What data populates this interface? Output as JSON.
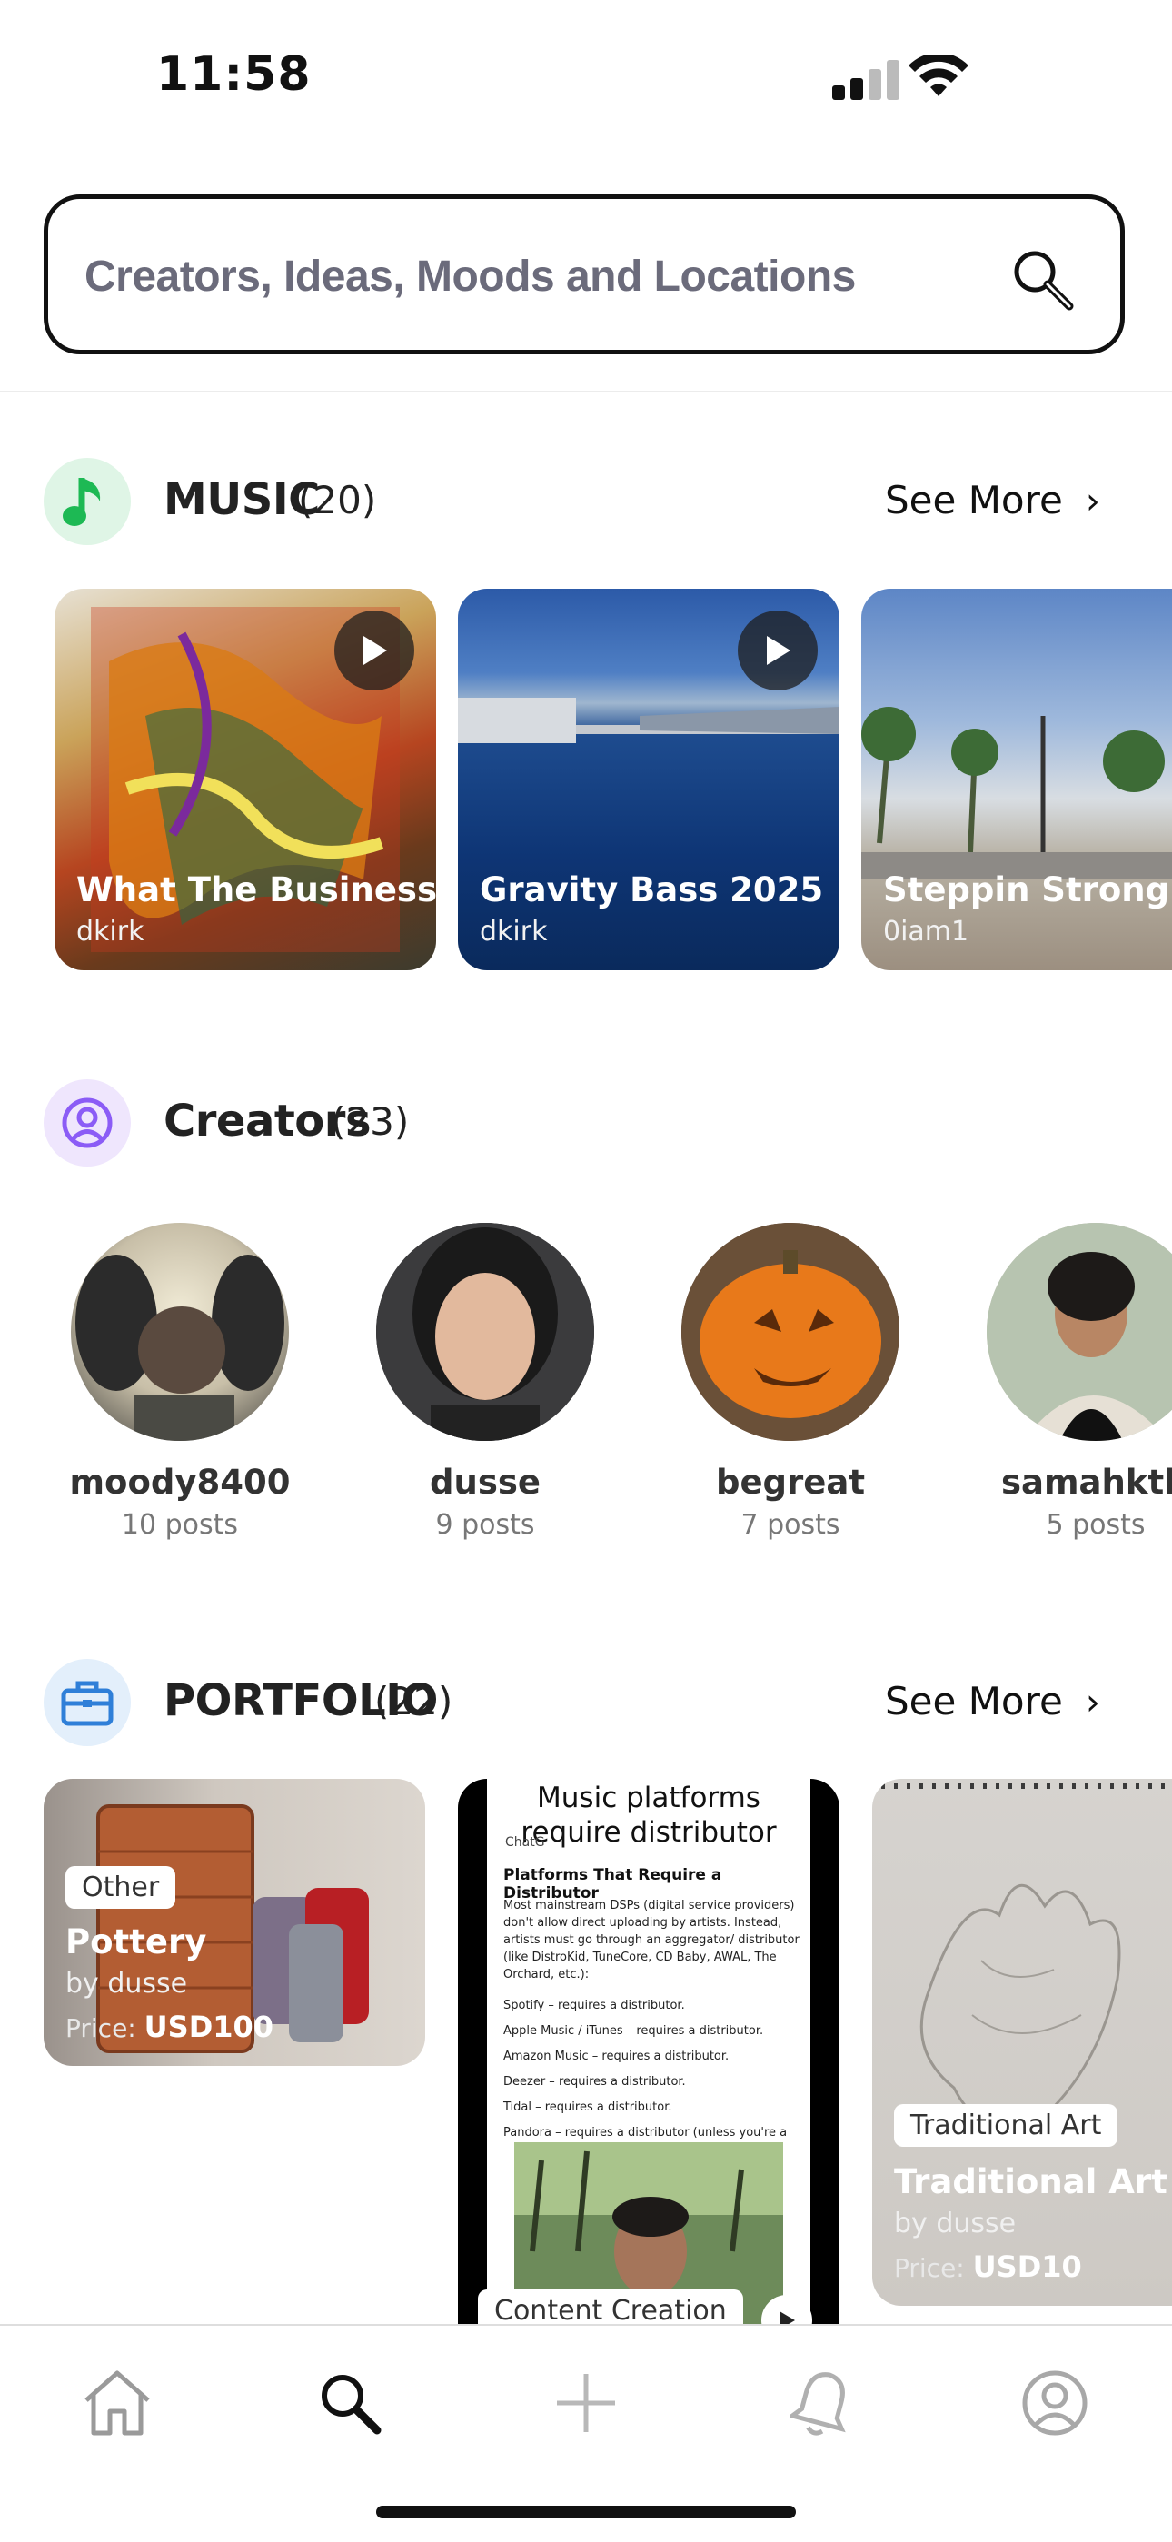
{
  "status": {
    "time": "11:58"
  },
  "search": {
    "placeholder": "Creators, Ideas, Moods and Locations"
  },
  "music": {
    "title": "MUSIC",
    "count": "(20)",
    "see_more": "See More",
    "icon": "music-note-icon",
    "accent": "#1db954",
    "items": [
      {
        "title": "What The Business (P..",
        "author": "dkirk"
      },
      {
        "title": "Gravity Bass 2025",
        "author": "dkirk"
      },
      {
        "title": "Steppin Strong",
        "author": "0iam1"
      }
    ]
  },
  "creators": {
    "title": "Creators",
    "count": "(23)",
    "icon": "user-circle-icon",
    "accent": "#8b5cf6",
    "items": [
      {
        "name": "moody8400",
        "posts": "10 posts"
      },
      {
        "name": "dusse",
        "posts": "9 posts"
      },
      {
        "name": "begreat",
        "posts": "7 posts"
      },
      {
        "name": "samahktha",
        "posts": "5 posts"
      }
    ]
  },
  "portfolio": {
    "title": "PORTFOLIO",
    "count": "(22)",
    "see_more": "See More",
    "icon": "briefcase-icon",
    "accent": "#2f7fd8",
    "items": [
      {
        "tag": "Other",
        "title": "Pottery",
        "by": "by dusse",
        "price_label": "Price:",
        "price": "USD100"
      },
      {
        "tag": "Content Creation",
        "headline": "Music platforms require distributor",
        "doc_header": "ChatG",
        "doc_title": "Platforms That Require a Distributor",
        "doc_body": "Most mainstream DSPs (digital service providers) don't allow direct uploading by artists. Instead, artists must go through an aggregator/ distributor (like DistroKid, TuneCore, CD Baby, AWAL, The Orchard, etc.):",
        "doc_list": [
          "Spotify – requires a distributor.",
          "Apple Music / iTunes – requires a distributor.",
          "Amazon Music – requires a distributor.",
          "Deezer – requires a distributor.",
          "Tidal – requires a distributor.",
          "Pandora – requires a distributor (unless you're a"
        ]
      },
      {
        "tag": "Traditional Art",
        "title": "Traditional Art",
        "by": "by dusse",
        "price_label": "Price:",
        "price": "USD10"
      }
    ]
  },
  "tabs": [
    {
      "name": "home",
      "icon": "home-icon"
    },
    {
      "name": "search",
      "icon": "search-icon"
    },
    {
      "name": "create",
      "icon": "plus-icon"
    },
    {
      "name": "notifications",
      "icon": "bell-icon"
    },
    {
      "name": "profile",
      "icon": "profile-icon"
    }
  ]
}
